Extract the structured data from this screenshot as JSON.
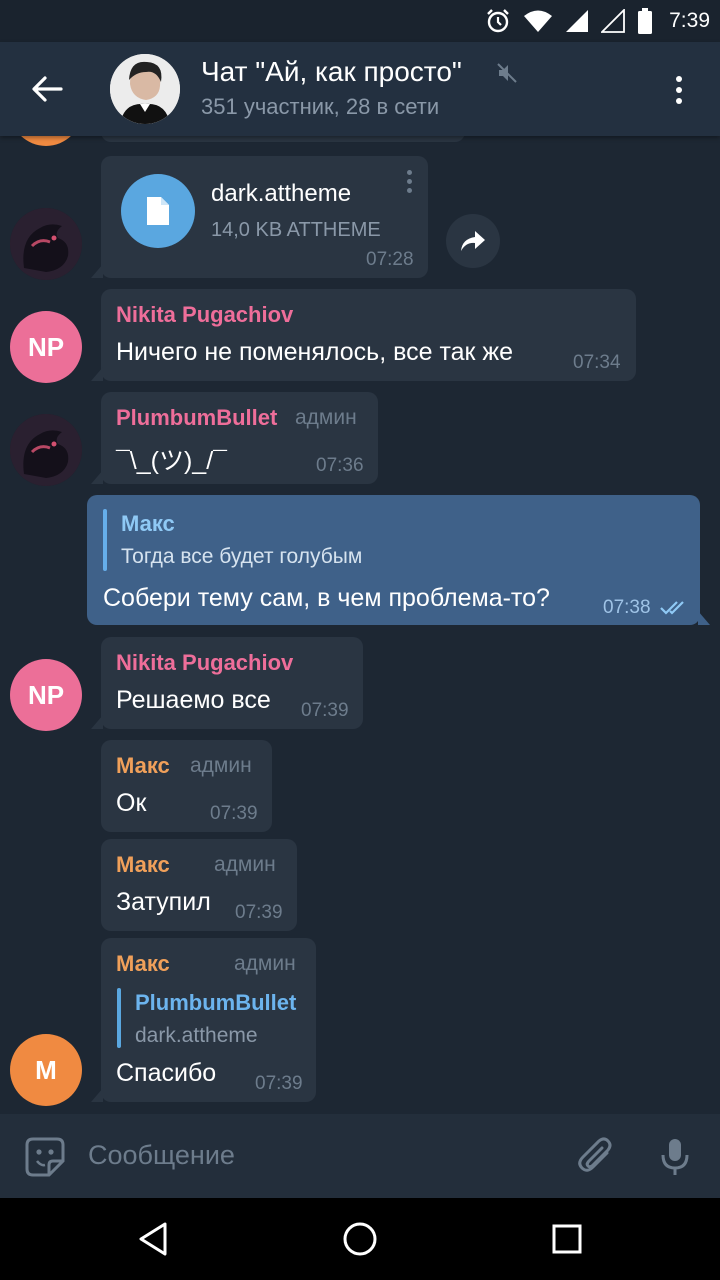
{
  "status_bar": {
    "time": "7:39"
  },
  "header": {
    "title": "Чат \"Ай, как просто\"",
    "subtitle": "351 участник, 28 в сети"
  },
  "messages": [
    {
      "type": "file",
      "file_name": "dark.attheme",
      "file_info": "14,0 KB ATTHEME",
      "time": "07:28"
    },
    {
      "sender": "Nikita Pugachiov",
      "avatar_initials": "NP",
      "text": "Ничего не поменялось, все так же",
      "time": "07:34"
    },
    {
      "sender": "PlumbumBullet",
      "badge": "админ",
      "text": "¯\\_(ツ)_/¯",
      "time": "07:36"
    },
    {
      "outgoing": true,
      "reply_name": "Макс",
      "reply_text": "Тогда все будет голубым",
      "text": "Собери тему сам, в чем проблема-то?",
      "time": "07:38"
    },
    {
      "sender": "Nikita Pugachiov",
      "avatar_initials": "NP",
      "text": "Решаемо все",
      "time": "07:39"
    },
    {
      "sender": "Макс",
      "badge": "админ",
      "text": "Ок",
      "time": "07:39"
    },
    {
      "sender": "Макс",
      "badge": "админ",
      "text": "Затупил",
      "time": "07:39"
    },
    {
      "sender": "Макс",
      "badge": "админ",
      "avatar_initials": "M",
      "reply_name": "PlumbumBullet",
      "reply_text": "dark.attheme",
      "text": "Спасибо",
      "time": "07:39"
    }
  ],
  "composer": {
    "placeholder": "Сообщение"
  },
  "colors": {
    "background": "#1d2733",
    "header": "#233040",
    "bubble_in": "#2a3542",
    "bubble_out": "#3f6189",
    "name_pink": "#ee6e9a",
    "name_orange": "#f0a05a",
    "avatar_pink": "#ec6f98",
    "avatar_orange": "#f08a41"
  }
}
